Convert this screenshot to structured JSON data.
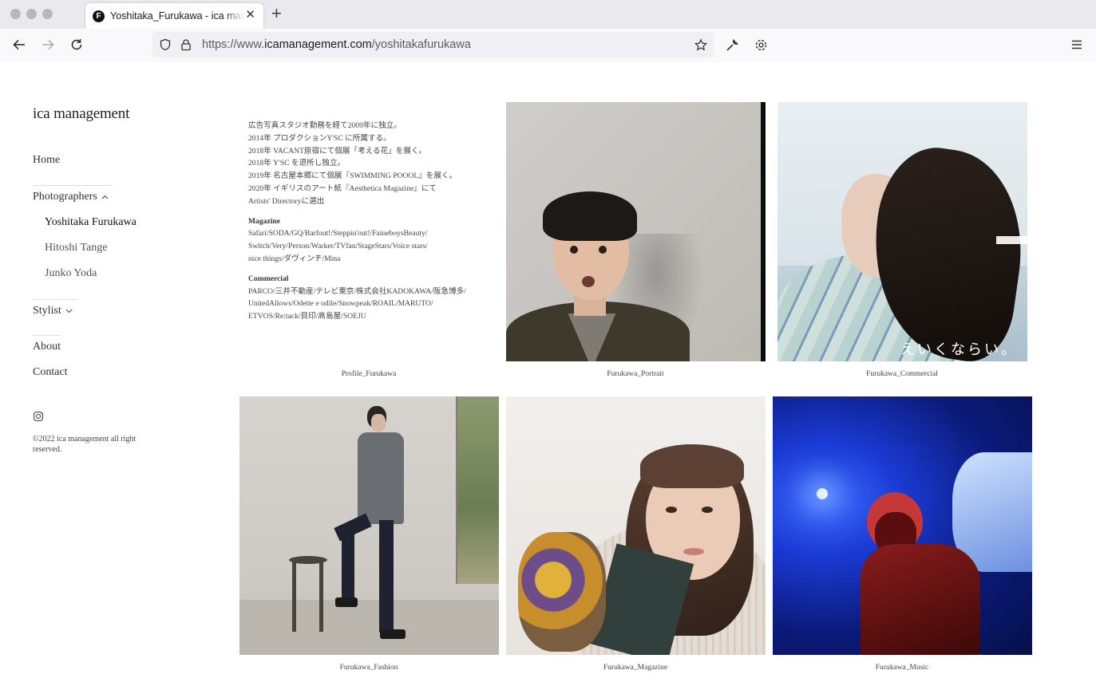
{
  "browser": {
    "tab_title": "Yoshitaka_Furukawa - ica management",
    "favicon_letter": "F",
    "url_prefix": "https://www.",
    "url_host": "icamanagement.com",
    "url_path": "/yoshitakafurukawa"
  },
  "sidebar": {
    "logo": "ica management",
    "home": "Home",
    "photographers": "Photographers",
    "photographer_items": [
      "Yoshitaka Furukawa",
      "Hitoshi Tange",
      "Junko Yoda"
    ],
    "stylist": "Stylist",
    "about": "About",
    "contact": "Contact",
    "copyright": "©2022 ica management all right reserved."
  },
  "profile": {
    "bio": [
      "広告写真スタジオ勤務を経て2009年に独立。",
      "2014年 プロダクションY'SC に所属する。",
      "2018年 VACANT原宿にて個展「考える花」を展く。",
      "2018年 Y'SC を退所し独立。",
      "2019年 名古屋本郷にて個展『SWIMMING POOOL』を展く。",
      "2020年 イギリスのアート紙『Aesthetica Magazine』にて",
      "Artists' Directoryに選出"
    ],
    "magazine_heading": "Magazine",
    "magazine_lines": [
      "Safari/SODA/GQ/Barfout!/Steppin'out!/FaineboysBeauty/",
      "Switch/Very/Person/Warker/TVfan/StageStars/Voice stars/",
      "nice things/ダヴィンチ/Mina"
    ],
    "commercial_heading": "Commercial",
    "commercial_lines": [
      "PARCO/三井不動産/テレビ東京/株式会社KADOKAWA/阪急博多/",
      "UnitedAllows/Odette e odile/Snowpeak/ROAIL/MARUTO/",
      "ETVOS/Re:tack/貝印/高島屋/SOEJU"
    ]
  },
  "gallery": {
    "captions": [
      "Profile_Furukawa",
      "Furukawa_Portrait",
      "Furukawa_Commercial",
      "Furukawa_Fashion",
      "Furukawa_Magazine",
      "Furukawa_Music"
    ],
    "commercial_overlay_text": "えいくならい。"
  },
  "colors": {
    "chrome": "#f0f0f4",
    "text": "#333333"
  }
}
